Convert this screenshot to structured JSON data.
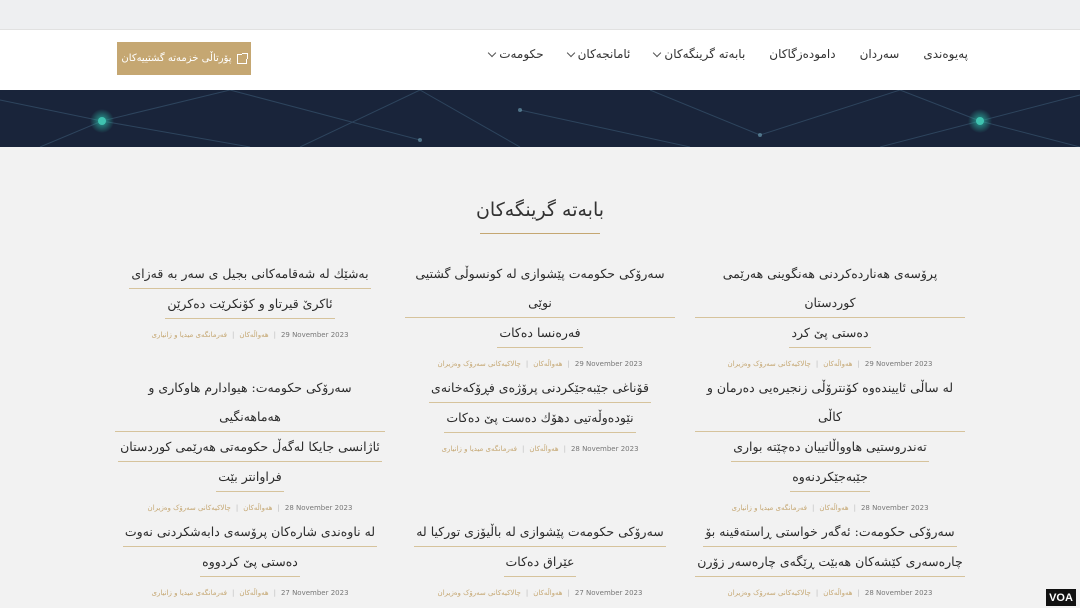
{
  "colors": {
    "accent": "#c5a772",
    "banner": "#19243a",
    "banner_node": "#2aa89a"
  },
  "portal_button": {
    "label": "پۆرتاڵی خزمەتە گشتییەکان",
    "icon": "external-link-icon"
  },
  "menu": [
    {
      "label": "حکومەت",
      "dropdown": true
    },
    {
      "label": "ئامانجەکان",
      "dropdown": true
    },
    {
      "label": "بابەتە گرینگەکان",
      "dropdown": true
    },
    {
      "label": "دامودەزگاکان",
      "dropdown": false
    },
    {
      "label": "سەردان",
      "dropdown": false
    },
    {
      "label": "پەیوەندی",
      "dropdown": false
    }
  ],
  "section_title": "بابەتە گرینگەکان",
  "articles": [
    {
      "lines": [
        "پرۆسەی هەناردەکردنی هەنگوینی هەرێمی کوردستان",
        "دەستی پێ کرد"
      ],
      "date": "29 November 2023",
      "tag1": "هەواڵەکان",
      "tag2": "چالاکیەکانی سەرۆک وەزیران"
    },
    {
      "lines": [
        "سەرۆکی حکومەت پێشوازی لە کونسوڵی گشتیی نوێی",
        "فەرەنسا دەکات"
      ],
      "date": "29 November 2023",
      "tag1": "هەواڵەکان",
      "tag2": "چالاکیەکانی سەرۆک وەزیران"
    },
    {
      "lines": [
        "بەشێك لە شەقامەکانی بجیل ی سەر بە قەزای",
        "ئاکرێ قیرتاو و کۆنکرێت دەکرێن"
      ],
      "date": "29 November 2023",
      "tag1": "هەواڵەکان",
      "tag2": "فەرمانگەی میدیا و زانیاری"
    },
    {
      "lines": [
        "لە ساڵی ئاییندەوە کۆنترۆڵی زنجیرەیی دەرمان و کاڵی",
        "تەندروستیی هاوواڵاتییان دەچێتە بواری",
        "جێبەجێکردنەوە"
      ],
      "date": "28 November 2023",
      "tag1": "هەواڵەکان",
      "tag2": "فەرمانگەی میدیا و زانیاری"
    },
    {
      "lines": [
        "قۆناغی جێبەجێکردنی پرۆژەی فڕۆکەخانەی",
        "نێودەوڵەتیی دهۆك دەست پێ دەکات"
      ],
      "date": "28 November 2023",
      "tag1": "هەواڵەکان",
      "tag2": "فەرمانگەی میدیا و زانیاری"
    },
    {
      "lines": [
        "سەرۆکی حکومەت: هیوادارم هاوکاری و هەماهەنگیی",
        "ئاژانسی جایکا لەگەڵ حکومەتی هەرێمی کوردستان",
        "فراوانتر بێت"
      ],
      "date": "28 November 2023",
      "tag1": "هەواڵەکان",
      "tag2": "چالاکیەکانی سەرۆک وەزیران"
    },
    {
      "lines": [
        "سەرۆکی حکومەت: ئەگەر خواستی ڕاستەقینە بۆ",
        "چارەسەری کێشەکان هەبێت ڕێگەی چارەسەر زۆرن"
      ],
      "date": "28 November 2023",
      "tag1": "هەواڵەکان",
      "tag2": "چالاکیەکانی سەرۆک وەزیران"
    },
    {
      "lines": [
        "سەرۆکی حکومەت پێشوازی لە باڵیۆزی تورکیا لە",
        "عێراق دەکات"
      ],
      "date": "27 November 2023",
      "tag1": "هەواڵەکان",
      "tag2": "چالاکیەکانی سەرۆک وەزیران"
    },
    {
      "lines": [
        "لە ناوەندی شارەکان پرۆسەی دابەشکردنی نەوت",
        "دەستی پێ کردووە"
      ],
      "date": "27 November 2023",
      "tag1": "هەواڵەکان",
      "tag2": "فەرمانگەی میدیا و زانیاری"
    }
  ],
  "watermark": "VOA"
}
